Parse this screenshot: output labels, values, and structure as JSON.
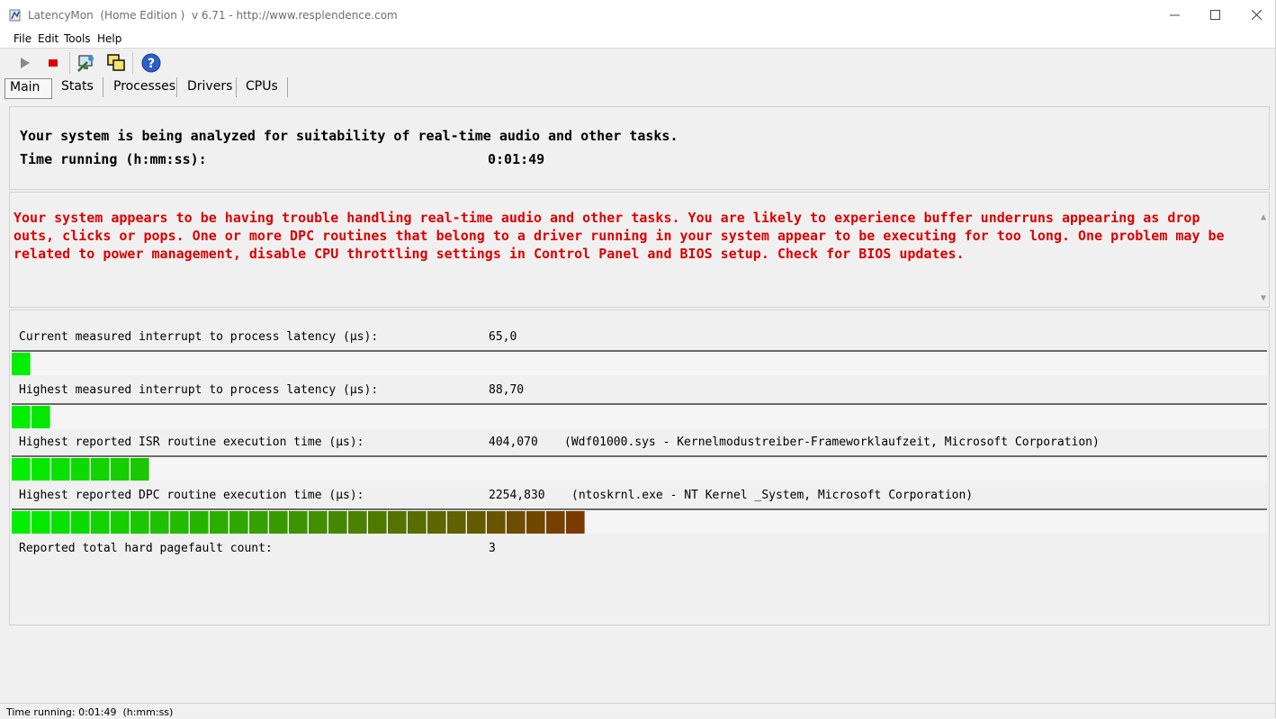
{
  "window": {
    "title": "LatencyMon  (Home Edition )  v 6.71 - http://www.resplendence.com"
  },
  "menu": {
    "file": "File",
    "edit": "Edit",
    "tools": "Tools",
    "help": "Help"
  },
  "tabs": [
    "Main",
    "Stats",
    "Processes",
    "Drivers",
    "CPUs"
  ],
  "main": {
    "analyzed_text": "Your system is being analyzed for suitability of real-time audio and other tasks.",
    "time_running_label": "Time running (h:mm:ss):",
    "time_running_value": "0:01:49",
    "warning": "Your system appears to be having trouble handling real-time audio and other tasks. You are likely to experience buffer underruns appearing as drop outs, clicks or pops. One or more DPC routines that belong to a driver running in your system appear to be executing for too long. One problem may be related to power management, disable CPU throttling settings in Control Panel and BIOS setup. Check for BIOS updates.",
    "metrics": [
      {
        "label": "Current measured interrupt to process latency (µs):",
        "value": "65,0",
        "detail": "",
        "bar_segments": 1
      },
      {
        "label": "Highest measured interrupt to process latency (µs):",
        "value": "88,70",
        "detail": "",
        "bar_segments": 2
      },
      {
        "label": "Highest reported ISR routine execution time (µs):",
        "value": "404,070",
        "detail": "(Wdf01000.sys - Kernelmodustreiber-Frameworklaufzeit, Microsoft Corporation)",
        "bar_segments": 7
      },
      {
        "label": "Highest reported DPC routine execution time (µs):",
        "value": "2254,830",
        "detail": "(ntoskrnl.exe - NT Kernel _System, Microsoft Corporation)",
        "bar_segments": 29
      }
    ],
    "pagefault_label": "Reported total hard pagefault count:",
    "pagefault_value": "3"
  },
  "status": {
    "text": "Time running: 0:01:49  (h:mm:ss)"
  },
  "colors": {
    "warning": "#dd0000",
    "bar_start": "#00ee00",
    "bar_end": "#7a3a00"
  },
  "icons": [
    "app-icon",
    "play-icon",
    "stop-icon",
    "monitor-icon",
    "windows-icon",
    "help-icon"
  ]
}
